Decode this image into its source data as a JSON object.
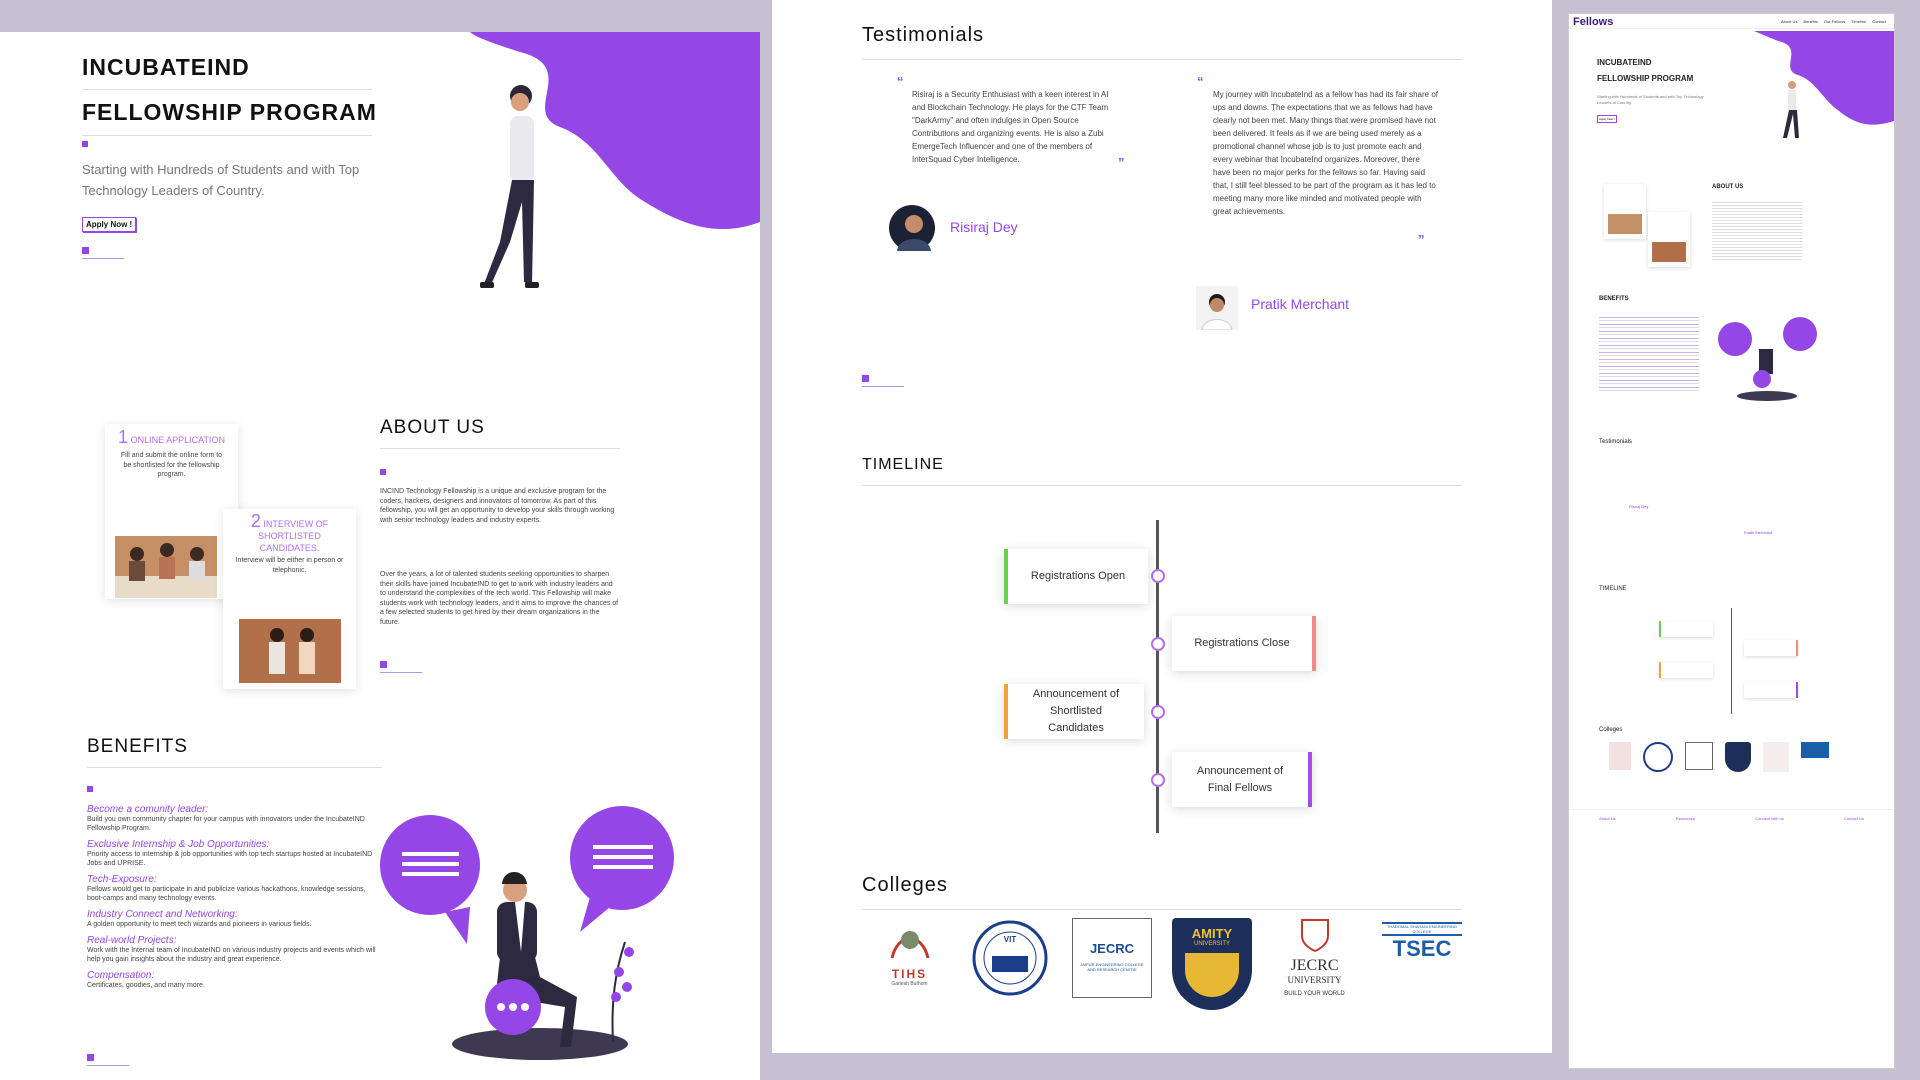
{
  "hero": {
    "title1": "INCUBATEIND",
    "title2": "FELLOWSHIP PROGRAM",
    "subtitle": "Starting with Hundreds of Students and with Top Technology Leaders of Country.",
    "apply": "Apply Now !"
  },
  "steps": [
    {
      "num": "1",
      "title": "ONLINE APPLICATION",
      "text": "Fill and submit the online form to be shortlisted for the fellowship program."
    },
    {
      "num": "2",
      "title": "INTERVIEW OF SHORTLISTED CANDIDATES.",
      "text": "Interview will be either in person or telephonic."
    }
  ],
  "about": {
    "heading": "ABOUT US",
    "p1": "INCIND Technology Fellowship is a unique and exclusive program for the coders, hackers, designers and innovators of tomorrow. As part of this fellowship, you will get an opportunity to develop your skills through working with senior technology leaders and industry experts.",
    "p2": "Over the years, a lot of talented students seeking opportunities to sharpen their skills have joined IncubateIND to get to work with industry leaders and to understand the complexities of the tech world. This Fellowship will make students work with technology leaders, and it aims to improve the chances of a few selected students to get hired by their dream organizations in the future."
  },
  "benefits": {
    "heading": "BENEFITS",
    "items": [
      {
        "title": "Become a comunity leader:",
        "text": "Build you own community chapter for your campus with innovators under the IncubateIND Fellowship Program."
      },
      {
        "title": "Exclusive Internship & Job Opportunities:",
        "text": "Priority access to internship & job opportunities with top tech startups hosted at IncubateIND Jobs and UPRISE."
      },
      {
        "title": "Tech-Exposure:",
        "text": "Fellows would get to participate in and publicize various hackathons, knowledge sessions, boot-camps and many technology events."
      },
      {
        "title": "Industry Connect and Networking:",
        "text": "A golden opportunity to meet tech wizards and pioneers in various fields."
      },
      {
        "title": "Real-world Projects:",
        "text": "Work with the Internal team of IncubateIND on various industry projects and events which will help you gain insights about the industry and great experience."
      },
      {
        "title": "Compensation:",
        "text": "Certificates, goodies, and many more."
      }
    ]
  },
  "testimonials": {
    "heading": "Testimonials",
    "items": [
      {
        "text": "Risiraj is a Security Enthusiast with a keen interest in AI and Blockchain Technology. He plays for the CTF Team \"DarkArmy\" and often indulges in Open Source Contributions and organizing events. He is also a Zubi EmergeTech Influencer and one of the members of InterSquad Cyber Intelligence.",
        "name": "Risiraj Dey"
      },
      {
        "text": "My journey with IncubateInd as a fellow has had its fair share of ups and downs. The expectations that we as fellows had have clearly not been met. Many things that were promised have not been delivered. It feels as if we are being used merely as a promotional channel whose job is to just promote each and every webinar that IncubateInd organizes. Moreover, there have been no major perks for the fellows so far. Having said that, I still feel blessed to be part of the program as it has led to meeting many more like minded and motivated people with great achievements.",
        "name": "Pratik Merchant"
      }
    ]
  },
  "timeline": {
    "heading": "TIMELINE",
    "items": [
      {
        "label": "Registrations Open",
        "color": "#6ad04f"
      },
      {
        "label": "Registrations Close",
        "color": "#f08b8b"
      },
      {
        "label": "Announcement of Shortlisted Candidates",
        "color": "#f0a23c"
      },
      {
        "label": "Announcement of Final Fellows",
        "color": "#a54be6"
      }
    ]
  },
  "colleges": {
    "heading": "Colleges",
    "logos": [
      {
        "text": "TIHS",
        "sub": "Ganesh Buthom"
      },
      {
        "text": "VIT",
        "sub": ""
      },
      {
        "text": "JECRC",
        "sub": "JAIPUR ENGINEERING COLLEGE AND RESEARCH CENTRE"
      },
      {
        "text": "AMITY",
        "sub": "UNIVERSITY"
      },
      {
        "text": "JECRC",
        "sub": "UNIVERSITY"
      },
      {
        "text": "TSEC",
        "sub": "THADOMAL SHAHANI ENGINEERING COLLEGE"
      }
    ],
    "jecrc_tagline": "BUILD YOUR WORLD"
  },
  "nav": {
    "logo": "Fellows",
    "links": [
      "About Us",
      "Benefits",
      "Our Fellows",
      "Timeline",
      "Contact"
    ]
  },
  "footer": {
    "cols": [
      "About Us",
      "Resources",
      "Connect with us",
      "Contact Us"
    ]
  },
  "colors": {
    "accent": "#9447e6",
    "bg": "#c7c0d3"
  }
}
